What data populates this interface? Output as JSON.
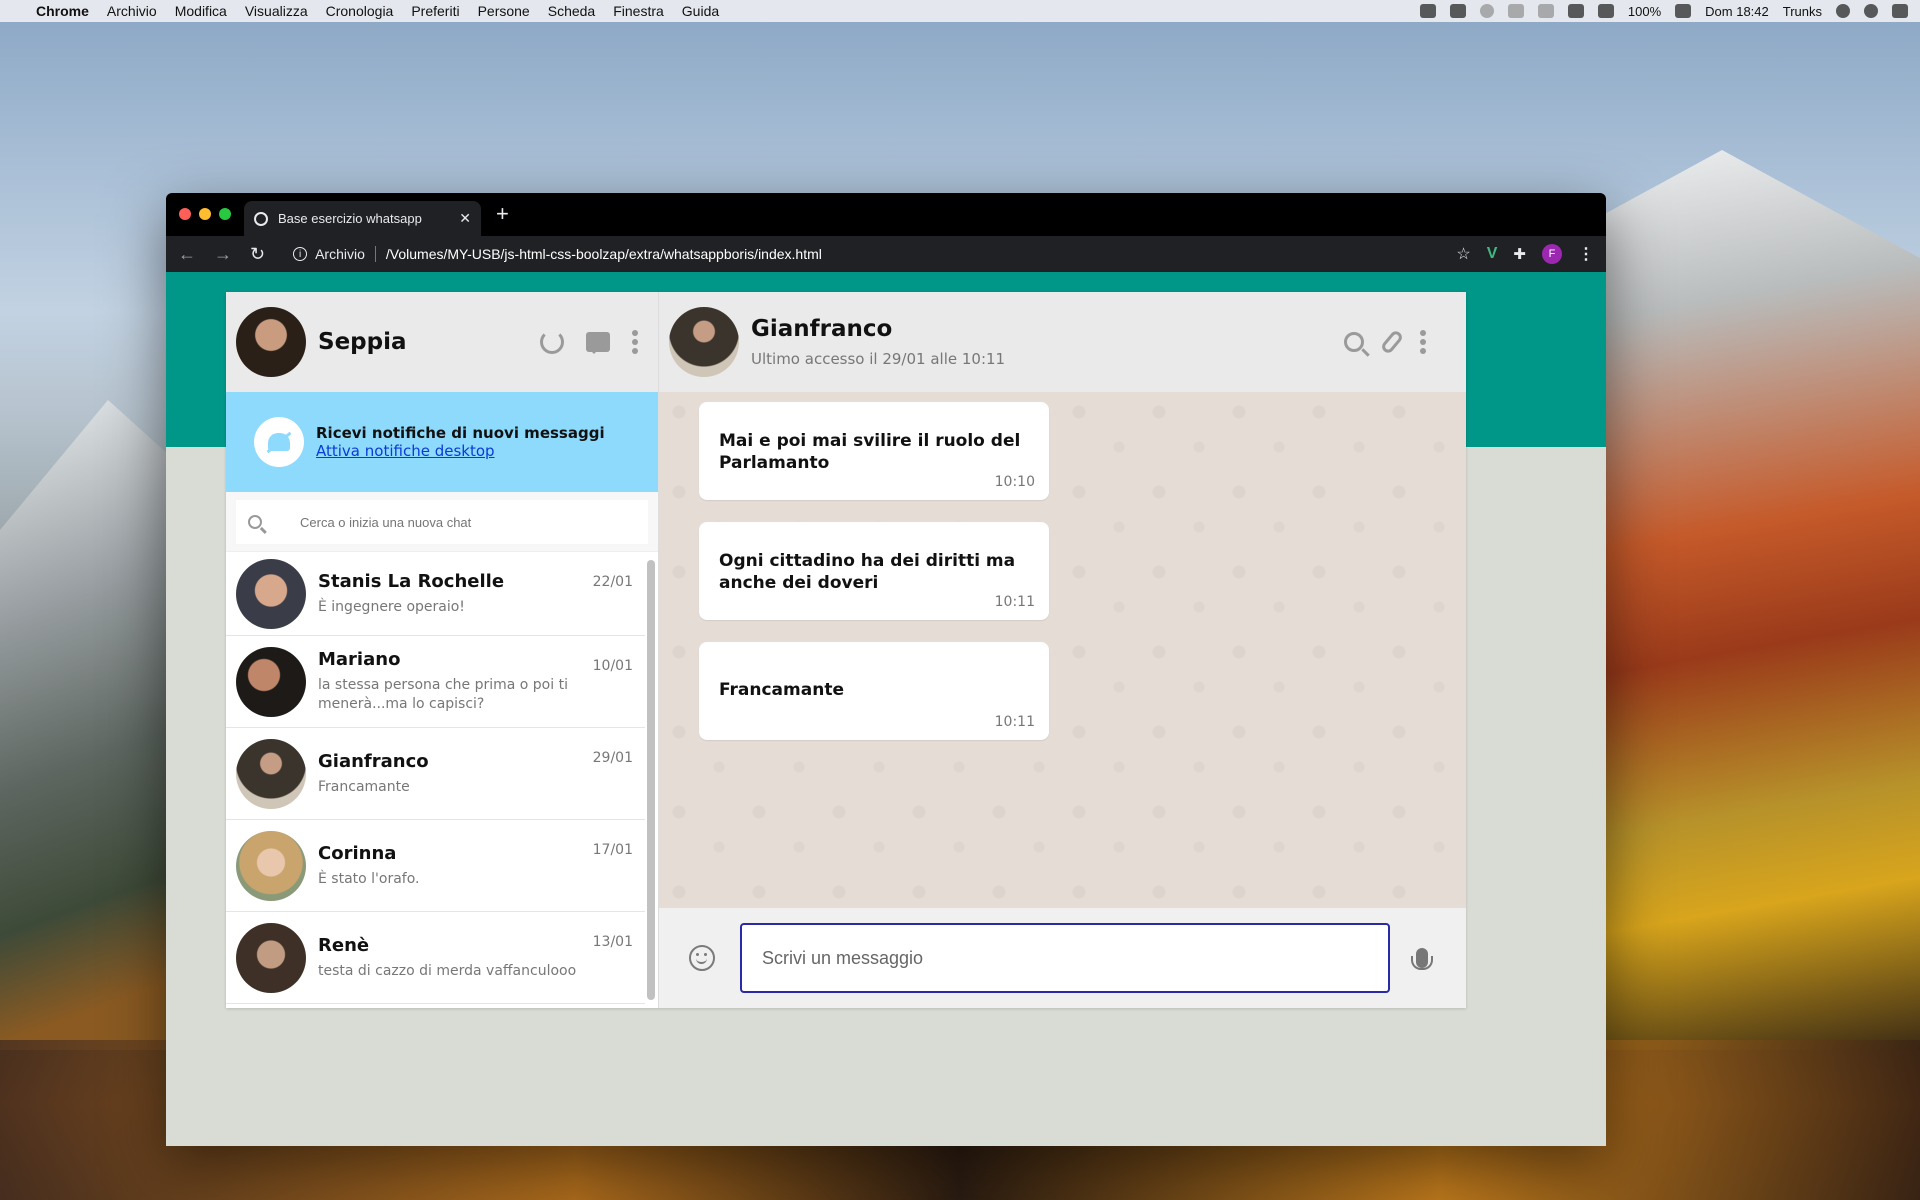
{
  "menubar": {
    "app_name": "Chrome",
    "menus": [
      "Archivio",
      "Modifica",
      "Visualizza",
      "Cronologia",
      "Preferiti",
      "Persone",
      "Scheda",
      "Finestra",
      "Guida"
    ],
    "battery": "100%",
    "clock": "Dom 18:42",
    "user": "Trunks"
  },
  "browser": {
    "tab_title": "Base esercizio whatsapp",
    "url_scheme_label": "Archivio",
    "url": "/Volumes/MY-USB/js-html-css-boolzap/extra/whatsappboris/index.html",
    "profile_initial": "F"
  },
  "sidebar": {
    "user_name": "Seppia",
    "notification": {
      "title": "Ricevi notifiche di nuovi messaggi",
      "link": "Attiva notifiche desktop"
    },
    "search_placeholder": "Cerca o inizia una nuova chat",
    "chats": [
      {
        "name": "Stanis La Rochelle",
        "preview": "È ingegnere operaio!",
        "date": "22/01"
      },
      {
        "name": "Mariano",
        "preview": "la stessa persona che prima o poi ti menerà...ma lo capisci?",
        "date": "10/01"
      },
      {
        "name": "Gianfranco",
        "preview": "Francamante",
        "date": "29/01"
      },
      {
        "name": "Corinna",
        "preview": "È stato l'orafo.",
        "date": "17/01"
      },
      {
        "name": "Renè",
        "preview": "testa di cazzo di merda vaffanculooo",
        "date": "13/01"
      }
    ]
  },
  "conversation": {
    "contact_name": "Gianfranco",
    "last_seen": "Ultimo accesso il 29/01 alle 10:11",
    "messages": [
      {
        "text": "Mai e poi mai svilire il ruolo del Parlamanto",
        "time": "10:10"
      },
      {
        "text": "Ogni cittadino ha dei diritti ma anche dei doveri",
        "time": "10:11"
      },
      {
        "text": "Francamante",
        "time": "10:11"
      }
    ],
    "composer_placeholder": "Scrivi un messaggio"
  },
  "colors": {
    "teal_header": "#009688",
    "notify_bg": "#8edafc",
    "chat_bg": "#e5ddd5"
  }
}
